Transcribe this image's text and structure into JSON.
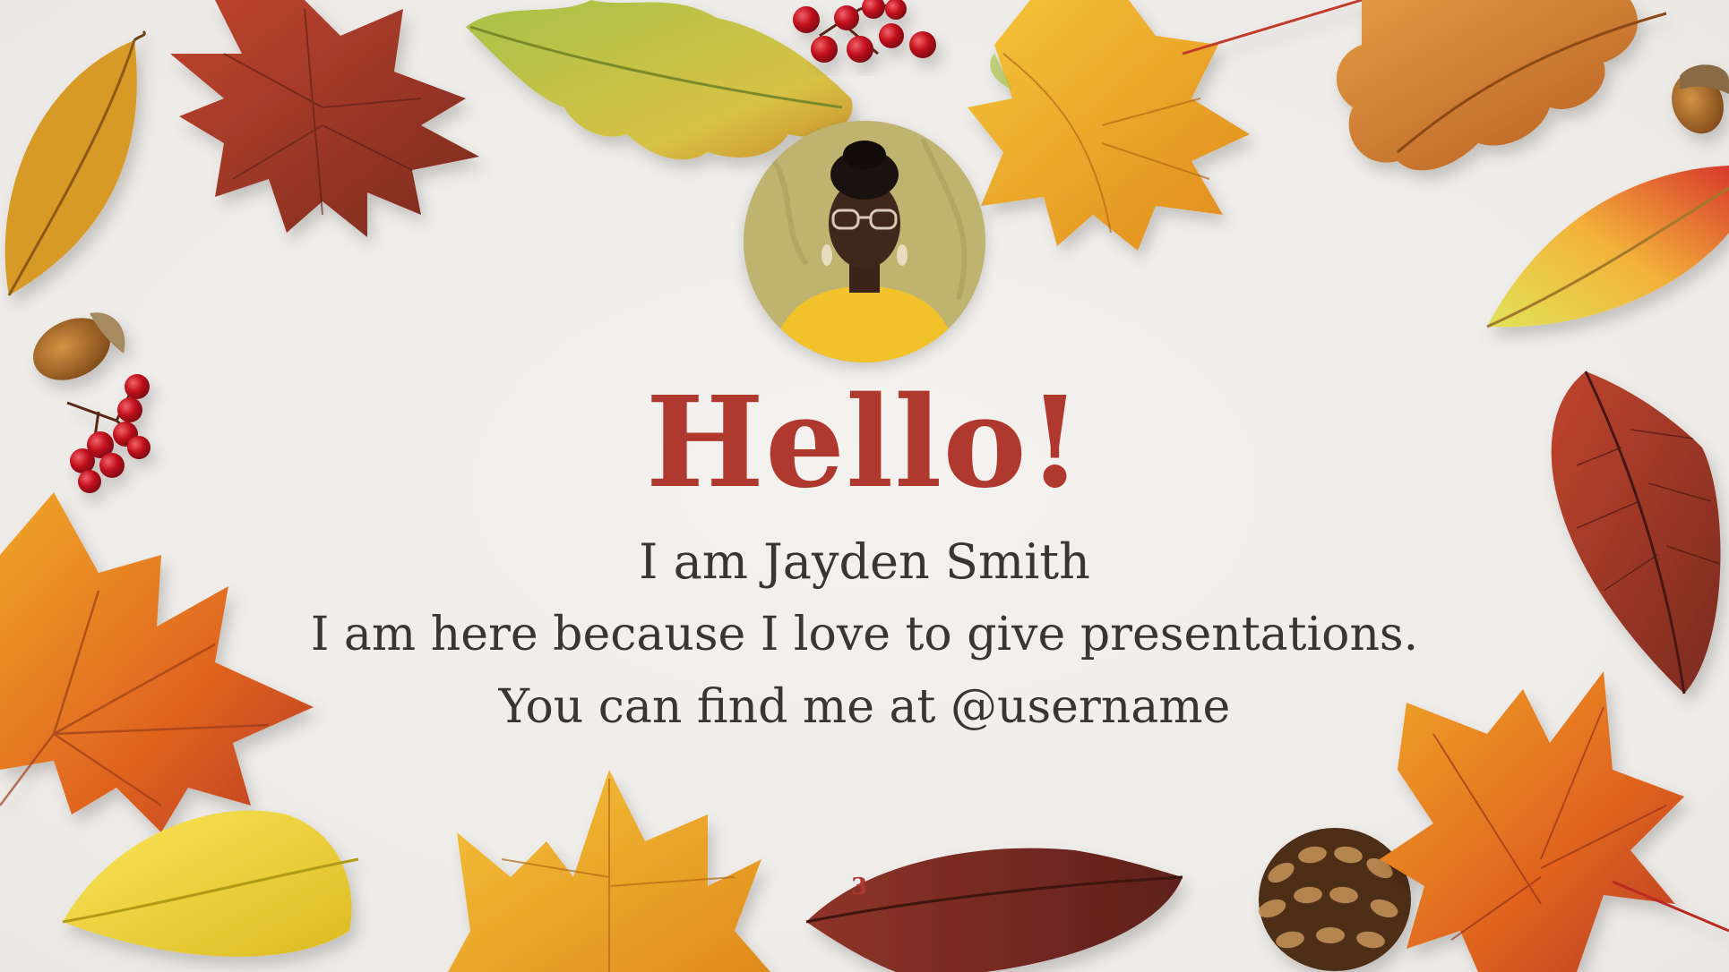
{
  "slide": {
    "title": "Hello!",
    "name_line": "I am Jayden Smith",
    "bio_line": "I am here because I love to give presentations.",
    "contact_line": "You can find me at @username",
    "page_number": "3"
  },
  "colors": {
    "background": "#f0eeeb",
    "accent": "#b0392f",
    "text": "#3a3535"
  },
  "decorations": [
    "maple-leaf",
    "oak-leaf",
    "birch-leaf",
    "acorn",
    "red-berries",
    "pine-cone",
    "profile-photo"
  ]
}
